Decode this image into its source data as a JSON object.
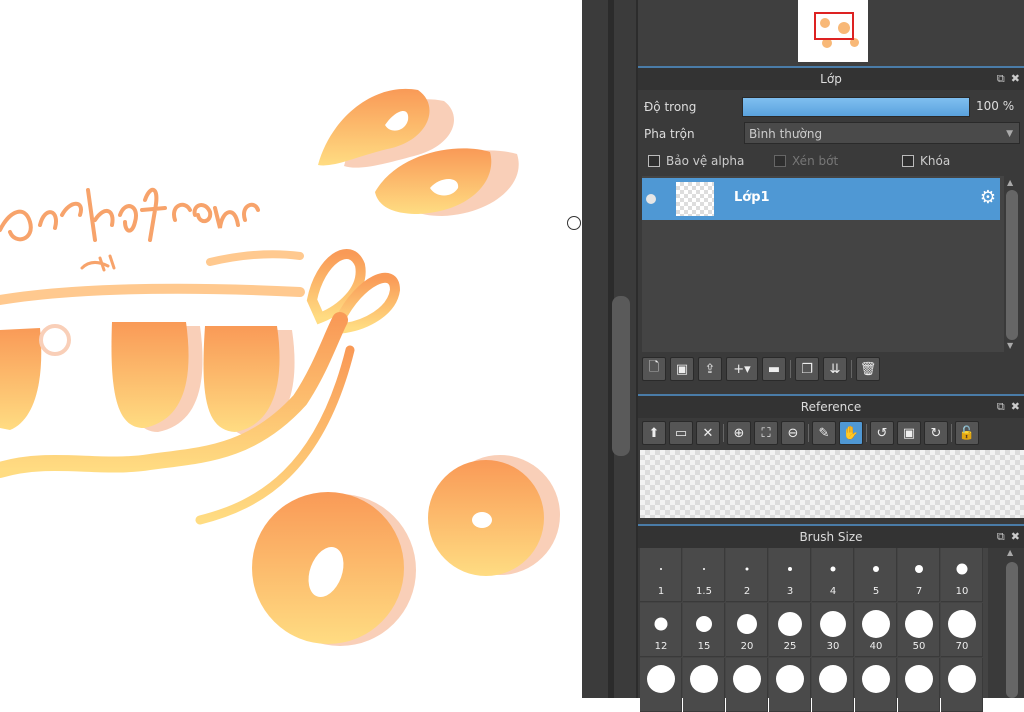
{
  "canvas": {
    "lettering_text": "dorkofcons",
    "colors": {
      "orange_top": "#f99a57",
      "orange_bottom": "#ffdc82",
      "shadow": "#f9cfb8"
    }
  },
  "layer_panel": {
    "title": "Lớp",
    "opacity_label": "Độ trong",
    "opacity_value": "100 %",
    "blend_label": "Pha trộn",
    "blend_value": "Bình thường",
    "protect_alpha": "Bảo vệ alpha",
    "clipping": "Xén bớt",
    "lock": "Khóa",
    "layers": [
      {
        "name": "Lớp1",
        "selected": true
      }
    ],
    "toolbar_icons": [
      "new-layer-icon",
      "new-raster-icon",
      "import-icon",
      "add-layer-menu-icon",
      "folder-icon",
      "duplicate-icon",
      "merge-icon",
      "delete-icon"
    ]
  },
  "reference_panel": {
    "title": "Reference",
    "toolbar_icons": [
      "upload-icon",
      "open-folder-icon",
      "close-icon",
      "zoom-in-icon",
      "fit-icon",
      "zoom-out-icon",
      "eyedropper-icon",
      "hand-icon",
      "rotate-left-icon",
      "fullscreen-icon",
      "rotate-right-icon",
      "lock-icon"
    ]
  },
  "brush_panel": {
    "title": "Brush Size",
    "sizes": [
      "1",
      "1.5",
      "2",
      "3",
      "4",
      "5",
      "7",
      "10",
      "12",
      "15",
      "20",
      "25",
      "30",
      "40",
      "50",
      "70",
      "",
      "",
      "",
      "",
      "",
      "",
      "",
      ""
    ]
  },
  "header_icons": {
    "float": "⧉",
    "close": "✖"
  }
}
